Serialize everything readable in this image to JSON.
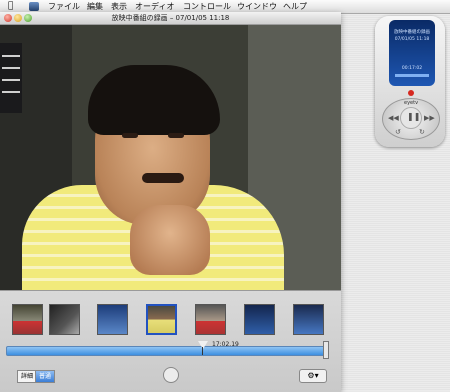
{
  "menubar": {
    "items": [
      "ファイル",
      "編集",
      "表示",
      "オーディオ",
      "コントロール",
      "ウインドウ",
      "ヘルプ"
    ]
  },
  "window": {
    "title": "放映中番組の録画 – 07/01/05 11:18"
  },
  "player": {
    "timecode": "17:02.19",
    "segment_buttons": [
      "詳細",
      "普通"
    ],
    "active_segment": "普通"
  },
  "remote": {
    "lcd_lines": [
      "放映中番組の録画",
      "07/01/05 11:18"
    ],
    "lcd_time": "00:17:02",
    "brand_label": "eyetv"
  },
  "colors": {
    "accent": "#3d8fe0",
    "thumb_selected": "#2252c0",
    "record_dot": "#d6281f"
  },
  "icons": {
    "apple": "apple-icon",
    "close": "close-icon",
    "minimize": "minimize-icon",
    "zoom": "zoom-icon",
    "gear": "gear-icon"
  }
}
